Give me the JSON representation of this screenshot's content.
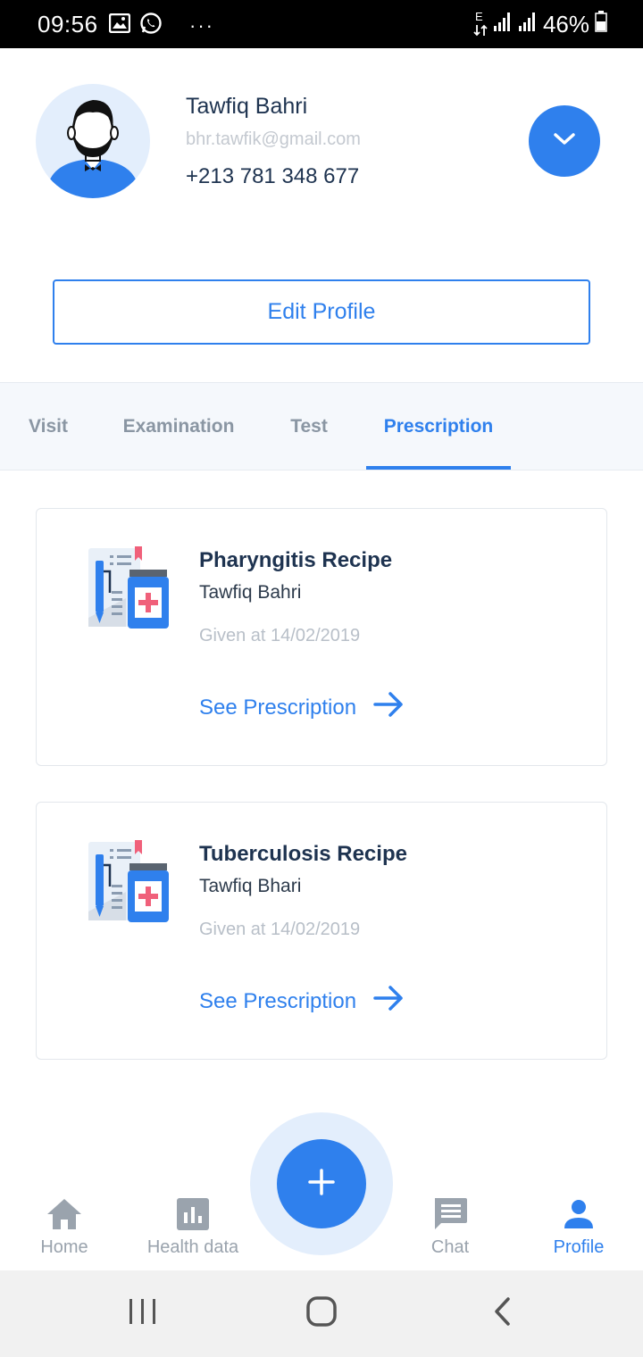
{
  "status_bar": {
    "time": "09:56",
    "battery": "46%",
    "more": "···",
    "net_type": "E"
  },
  "profile": {
    "name": "Tawfiq Bahri",
    "email": "bhr.tawfik@gmail.com",
    "phone": "+213 781 348 677",
    "expand_icon": "chevron-down-icon",
    "edit_label": "Edit Profile"
  },
  "tabs": [
    {
      "label": "Visit",
      "active": false
    },
    {
      "label": "Examination",
      "active": false
    },
    {
      "label": "Test",
      "active": false
    },
    {
      "label": "Prescription",
      "active": true
    }
  ],
  "prescriptions": [
    {
      "title": "Pharyngitis Recipe",
      "patient": "Tawfiq Bahri",
      "date": "Given at 14/02/2019",
      "link": "See Prescription"
    },
    {
      "title": "Tuberculosis Recipe",
      "patient": "Tawfiq Bhari",
      "date": "Given at 14/02/2019",
      "link": "See Prescription"
    }
  ],
  "bottom_nav": {
    "items": [
      {
        "label": "Home",
        "icon": "home-icon",
        "active": false
      },
      {
        "label": "Health data",
        "icon": "bar-chart-icon",
        "active": false
      },
      {
        "label": "Chat",
        "icon": "chat-icon",
        "active": false
      },
      {
        "label": "Profile",
        "icon": "person-icon",
        "active": true
      }
    ],
    "fab_icon": "plus-icon"
  },
  "colors": {
    "accent": "#2f80ed",
    "text_dark": "#1e3350",
    "muted": "#b8bfc8",
    "tab_inactive": "#8a96a3"
  }
}
